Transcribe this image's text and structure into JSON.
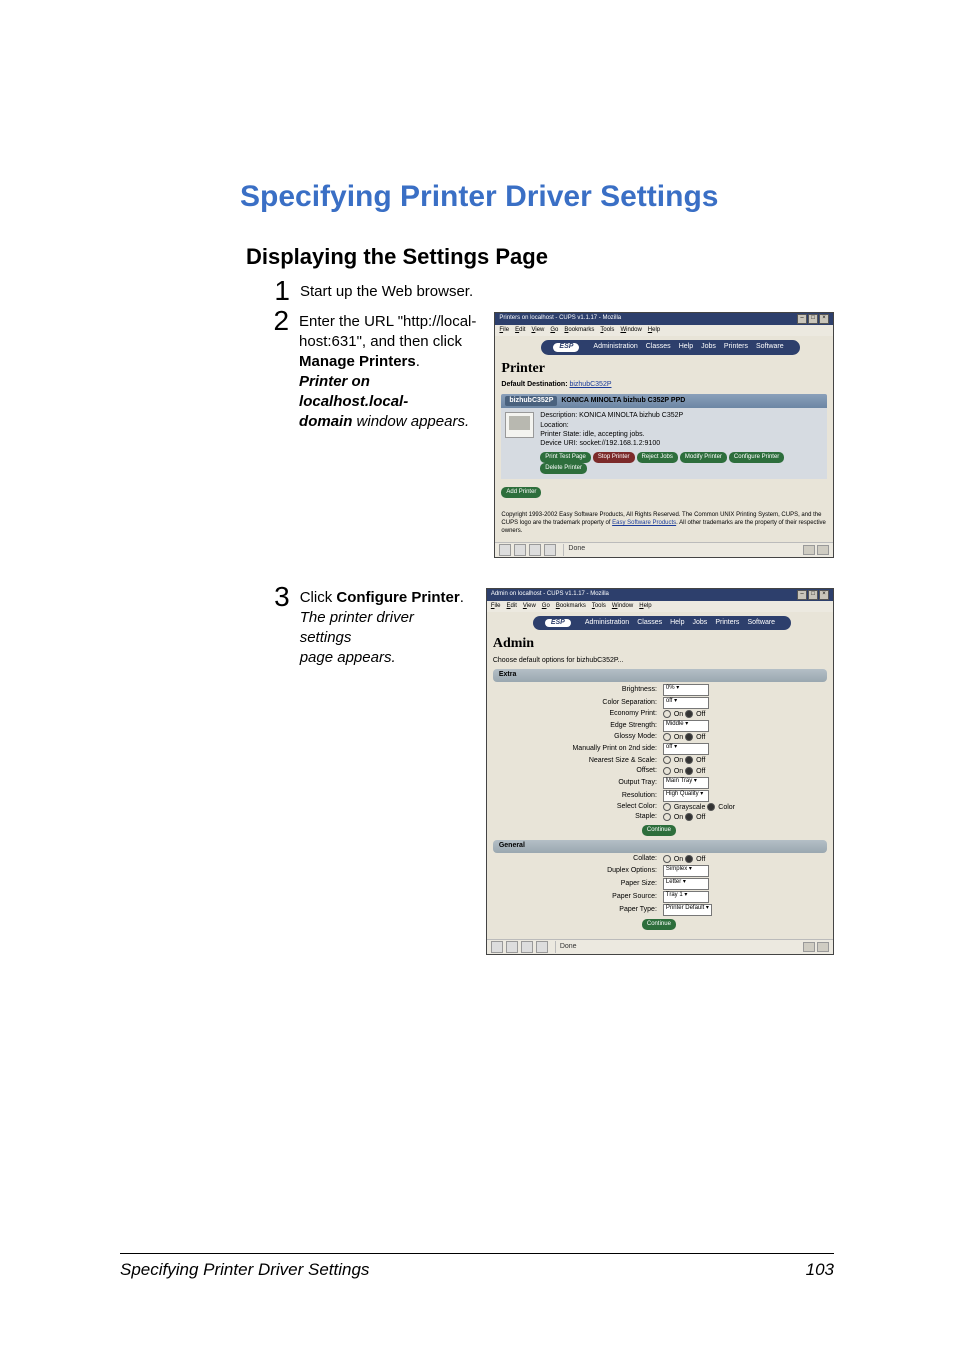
{
  "heading": "Specifying Printer Driver Settings",
  "subheading": "Displaying the Settings Page",
  "steps": {
    "s1": {
      "num": "1",
      "text": "Start up the Web browser."
    },
    "s2": {
      "num": "2",
      "line1a": "Enter the URL \"http://local-",
      "line1b": "host:631\", and then click ",
      "bold": "Manage Printers",
      "dot": ".",
      "italic1": "Printer on localhost.local-",
      "italic2": "domain",
      "italic3": " window appears."
    },
    "s3": {
      "num": "3",
      "pre": "Click ",
      "bold": "Configure Printer",
      "dot": ".",
      "italic1": "The printer driver settings ",
      "italic2": "page appears."
    }
  },
  "shot1": {
    "title": "Printers on localhost - CUPS v1.1.17 - Mozilla",
    "menus": [
      "File",
      "Edit",
      "View",
      "Go",
      "Bookmarks",
      "Tools",
      "Window",
      "Help"
    ],
    "tabs": {
      "esp": "ESP",
      "items": [
        "Administration",
        "Classes",
        "Help",
        "Jobs",
        "Printers",
        "Software"
      ]
    },
    "h3": "Printer",
    "defdest_lbl": "Default Destination: ",
    "defdest_link": "bizhubC352P",
    "prhdr_link": "bizhubC352P",
    "prhdr_rest": "KONICA MINOLTA bizhub C352P PPD",
    "desc": "Description: KONICA MINOLTA bizhub C352P",
    "loc": "Location:",
    "state": "Printer State: idle, accepting jobs.",
    "uri": "Device URI: socket://192.168.1.2:9100",
    "btns": [
      "Print Test Page",
      "Stop Printer",
      "Reject Jobs",
      "Modify Printer",
      "Configure Printer",
      "Delete Printer"
    ],
    "addbtn": "Add Printer",
    "copy1": "Copyright 1993-2002 Easy Software Products, All Rights Reserved. The Common UNIX Printing System, CUPS, and the CUPS logo are the trademark property of ",
    "copy_link": "Easy Software Products",
    "copy2": ". All other trademarks are the property of their respective owners.",
    "status": "Done"
  },
  "shot2": {
    "title": "Admin on localhost - CUPS v1.1.17 - Mozilla",
    "menus": [
      "File",
      "Edit",
      "View",
      "Go",
      "Bookmarks",
      "Tools",
      "Window",
      "Help"
    ],
    "tabs": {
      "esp": "ESP",
      "items": [
        "Administration",
        "Classes",
        "Help",
        "Jobs",
        "Printers",
        "Software"
      ]
    },
    "h3": "Admin",
    "choose": "Choose default options for bizhubC352P...",
    "sec_extra": "Extra",
    "extra": [
      {
        "lbl": "Brightness:",
        "type": "select",
        "val": "0%"
      },
      {
        "lbl": "Color Separation:",
        "type": "select",
        "val": "off"
      },
      {
        "lbl": "Economy Print:",
        "type": "radio",
        "on": "On",
        "off": "Off",
        "sel": "off"
      },
      {
        "lbl": "Edge Strength:",
        "type": "select",
        "val": "Middle"
      },
      {
        "lbl": "Glossy Mode:",
        "type": "radio",
        "on": "On",
        "off": "Off",
        "sel": "off"
      },
      {
        "lbl": "Manually Print on 2nd side:",
        "type": "select",
        "val": "off"
      },
      {
        "lbl": "Nearest Size & Scale:",
        "type": "radio",
        "on": "On",
        "off": "Off",
        "sel": "off"
      },
      {
        "lbl": "Offset:",
        "type": "radio",
        "on": "On",
        "off": "Off",
        "sel": "off"
      },
      {
        "lbl": "Output Tray:",
        "type": "select",
        "val": "Main Tray"
      },
      {
        "lbl": "Resolution:",
        "type": "select",
        "val": "High Quality"
      },
      {
        "lbl": "Select Color:",
        "type": "radio",
        "on": "Grayscale",
        "off": "Color",
        "sel": "off"
      },
      {
        "lbl": "Staple:",
        "type": "radio",
        "on": "On",
        "off": "Off",
        "sel": "off"
      }
    ],
    "continue": "Continue",
    "sec_general": "General",
    "general": [
      {
        "lbl": "Collate:",
        "type": "radio",
        "on": "On",
        "off": "Off",
        "sel": "off"
      },
      {
        "lbl": "Duplex Options:",
        "type": "select",
        "val": "Simplex"
      },
      {
        "lbl": "Paper Size:",
        "type": "select",
        "val": "Letter"
      },
      {
        "lbl": "Paper Source:",
        "type": "select",
        "val": "Tray 1"
      },
      {
        "lbl": "Paper Type:",
        "type": "select",
        "val": "Printer Default"
      }
    ],
    "status": "Done"
  },
  "footer": {
    "left": "Specifying Printer Driver Settings",
    "right": "103"
  }
}
